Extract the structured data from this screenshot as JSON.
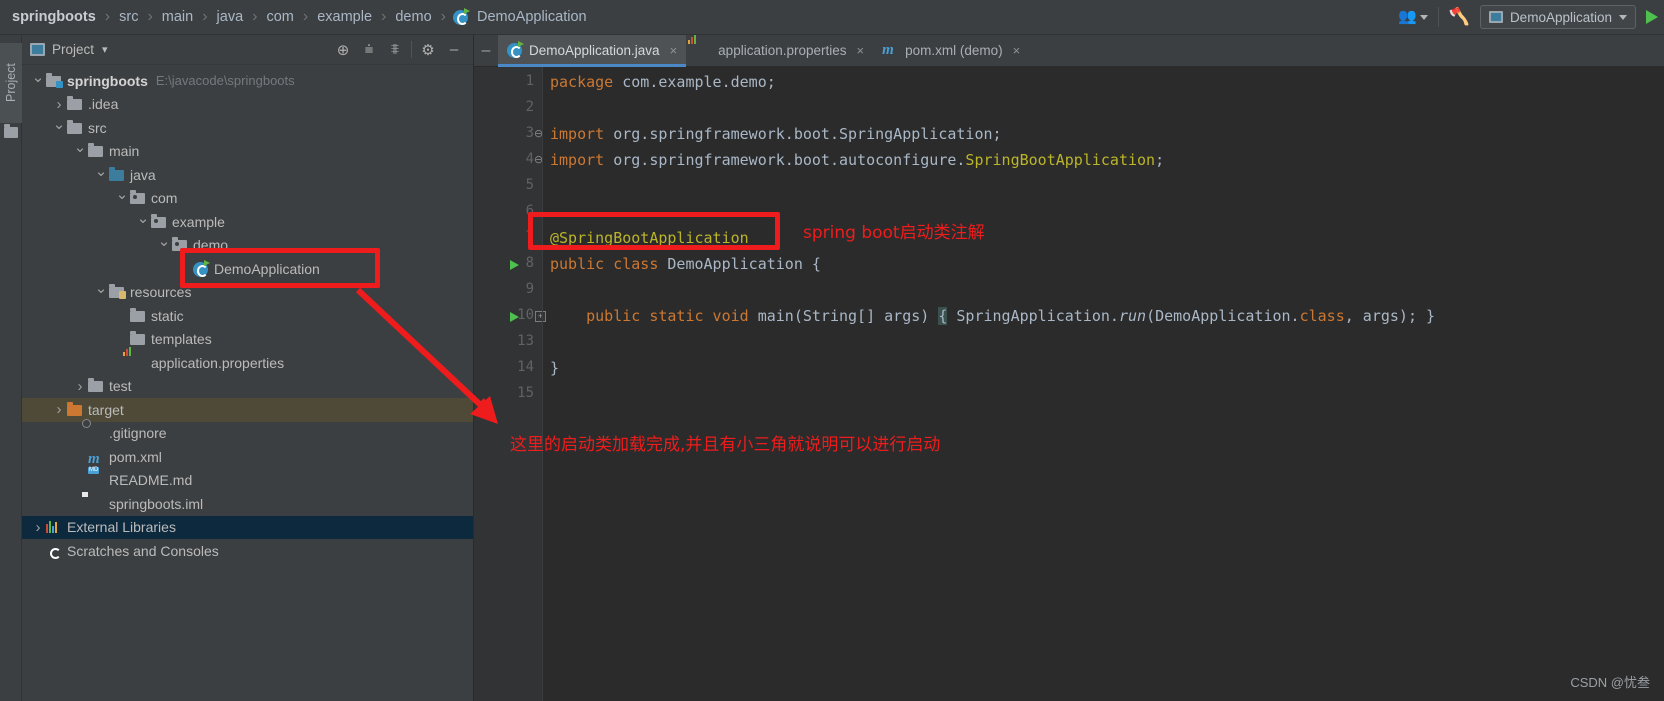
{
  "breadcrumb": {
    "items": [
      {
        "label": "springboots",
        "icon": "none",
        "root": true
      },
      {
        "label": "src",
        "icon": "none"
      },
      {
        "label": "main",
        "icon": "none"
      },
      {
        "label": "java",
        "icon": "none"
      },
      {
        "label": "com",
        "icon": "none"
      },
      {
        "label": "example",
        "icon": "none"
      },
      {
        "label": "demo",
        "icon": "none"
      },
      {
        "label": "DemoApplication",
        "icon": "spring-class-icon"
      }
    ],
    "separator": "›"
  },
  "toolbar": {
    "people_icon": "people-icon",
    "build_icon": "hammer-icon",
    "run_config": "DemoApplication",
    "run_icon": "run-play-icon",
    "dropdown_icon": "chevron-down-icon"
  },
  "left_strip": {
    "project_tab": "Project"
  },
  "project_panel": {
    "title": "Project",
    "title_caret": "▾",
    "buttons": [
      {
        "name": "locate-icon",
        "glyph": "⊕"
      },
      {
        "name": "expand-all-icon",
        "glyph": "⩧"
      },
      {
        "name": "collapse-all-icon",
        "glyph": "⩨"
      },
      {
        "name": "settings-gear-icon",
        "glyph": "⚙"
      },
      {
        "name": "hide-panel-icon",
        "glyph": "–"
      }
    ],
    "tree": [
      {
        "label": "springboots",
        "path": "E:\\javacode\\springboots",
        "indent": 0,
        "arrow": "down",
        "icon": "module-folder",
        "bold": true,
        "state": "none"
      },
      {
        "label": ".idea",
        "path": "",
        "indent": 1,
        "arrow": "right",
        "icon": "folder",
        "bold": false,
        "state": "none"
      },
      {
        "label": "src",
        "path": "",
        "indent": 1,
        "arrow": "down",
        "icon": "folder",
        "bold": false,
        "state": "none"
      },
      {
        "label": "main",
        "path": "",
        "indent": 2,
        "arrow": "down",
        "icon": "folder",
        "bold": false,
        "state": "none"
      },
      {
        "label": "java",
        "path": "",
        "indent": 3,
        "arrow": "down",
        "icon": "source-folder",
        "bold": false,
        "state": "none"
      },
      {
        "label": "com",
        "path": "",
        "indent": 4,
        "arrow": "down",
        "icon": "package",
        "bold": false,
        "state": "none"
      },
      {
        "label": "example",
        "path": "",
        "indent": 5,
        "arrow": "down",
        "icon": "package",
        "bold": false,
        "state": "none"
      },
      {
        "label": "demo",
        "path": "",
        "indent": 6,
        "arrow": "down",
        "icon": "package",
        "bold": false,
        "state": "none"
      },
      {
        "label": "DemoApplication",
        "path": "",
        "indent": 7,
        "arrow": "none",
        "icon": "spring-class",
        "bold": false,
        "state": "none"
      },
      {
        "label": "resources",
        "path": "",
        "indent": 3,
        "arrow": "down",
        "icon": "resource-folder",
        "bold": false,
        "state": "none"
      },
      {
        "label": "static",
        "path": "",
        "indent": 4,
        "arrow": "none",
        "icon": "folder",
        "bold": false,
        "state": "none"
      },
      {
        "label": "templates",
        "path": "",
        "indent": 4,
        "arrow": "none",
        "icon": "folder",
        "bold": false,
        "state": "none"
      },
      {
        "label": "application.properties",
        "path": "",
        "indent": 4,
        "arrow": "none",
        "icon": "properties-file",
        "bold": false,
        "state": "none"
      },
      {
        "label": "test",
        "path": "",
        "indent": 2,
        "arrow": "right",
        "icon": "folder",
        "bold": false,
        "state": "none"
      },
      {
        "label": "target",
        "path": "",
        "indent": 1,
        "arrow": "right",
        "icon": "orange-folder",
        "bold": false,
        "state": "hovered"
      },
      {
        "label": ".gitignore",
        "path": "",
        "indent": 2,
        "arrow": "none",
        "icon": "gitignore-file",
        "bold": false,
        "state": "none"
      },
      {
        "label": "pom.xml",
        "path": "",
        "indent": 2,
        "arrow": "none",
        "icon": "maven-file",
        "bold": false,
        "state": "none"
      },
      {
        "label": "README.md",
        "path": "",
        "indent": 2,
        "arrow": "none",
        "icon": "markdown-file",
        "bold": false,
        "state": "none"
      },
      {
        "label": "springboots.iml",
        "path": "",
        "indent": 2,
        "arrow": "none",
        "icon": "iml-file",
        "bold": false,
        "state": "none"
      },
      {
        "label": "External Libraries",
        "path": "",
        "indent": 0,
        "arrow": "right",
        "icon": "libraries",
        "bold": false,
        "state": "selected"
      },
      {
        "label": "Scratches and Consoles",
        "path": "",
        "indent": 0,
        "arrow": "none",
        "icon": "scratches",
        "bold": false,
        "state": "none"
      }
    ]
  },
  "editor": {
    "tabs": [
      {
        "label": "DemoApplication.java",
        "icon": "spring-class-icon",
        "active": true,
        "close": "×"
      },
      {
        "label": "application.properties",
        "icon": "properties-icon",
        "active": false,
        "close": "×"
      },
      {
        "label": "pom.xml (demo)",
        "icon": "maven-icon",
        "active": false,
        "close": "×"
      }
    ],
    "line_numbers": [
      "1",
      "2",
      "3",
      "4",
      "5",
      "6",
      "7",
      "8",
      "9",
      "10",
      "13",
      "14",
      "15"
    ],
    "code": [
      {
        "num": "1",
        "segments": [
          {
            "t": "package",
            "c": "kw"
          },
          {
            "t": " com.example.demo;",
            "c": "light"
          }
        ]
      },
      {
        "num": "2",
        "segments": []
      },
      {
        "num": "3",
        "segments": [
          {
            "t": "import",
            "c": "kw"
          },
          {
            "t": " org.springframework.boot.SpringApplication;",
            "c": "light"
          }
        ]
      },
      {
        "num": "4",
        "segments": [
          {
            "t": "import",
            "c": "kw"
          },
          {
            "t": " org.springframework.boot.autoconfigure.",
            "c": "light"
          },
          {
            "t": "SpringBootApplication",
            "c": "anno"
          },
          {
            "t": ";",
            "c": "light"
          }
        ]
      },
      {
        "num": "5",
        "segments": []
      },
      {
        "num": "6",
        "segments": []
      },
      {
        "num": "7",
        "segments": [
          {
            "t": "@SpringBootApplication",
            "c": "anno"
          }
        ]
      },
      {
        "num": "8",
        "segments": [
          {
            "t": "public class",
            "c": "kw"
          },
          {
            "t": " DemoApplication {",
            "c": "light"
          }
        ]
      },
      {
        "num": "9",
        "segments": []
      },
      {
        "num": "10",
        "segments": [
          {
            "t": "    public static void",
            "c": "kw"
          },
          {
            "t": " main(String[] args) ",
            "c": "light"
          },
          {
            "t": "{",
            "c": "brace"
          },
          {
            "t": " SpringApplication.",
            "c": "light"
          },
          {
            "t": "run",
            "c": "ital"
          },
          {
            "t": "(DemoApplication.",
            "c": "light"
          },
          {
            "t": "class",
            "c": "kw"
          },
          {
            "t": ", args); }",
            "c": "light"
          }
        ]
      },
      {
        "num": "13",
        "segments": []
      },
      {
        "num": "14",
        "segments": [
          {
            "t": "}",
            "c": "light"
          }
        ]
      },
      {
        "num": "15",
        "segments": []
      }
    ]
  },
  "annotations": {
    "tree_box_label": "DemoApplication highlight box",
    "code_box_label": "@SpringBootApplication highlight box",
    "note_annotation": "spring boot启动类注解",
    "note_bottom": "这里的启动类加载完成,并且有小三角就说明可以进行启动",
    "color": "#ee1c1c"
  },
  "watermark": "CSDN @忧叁"
}
